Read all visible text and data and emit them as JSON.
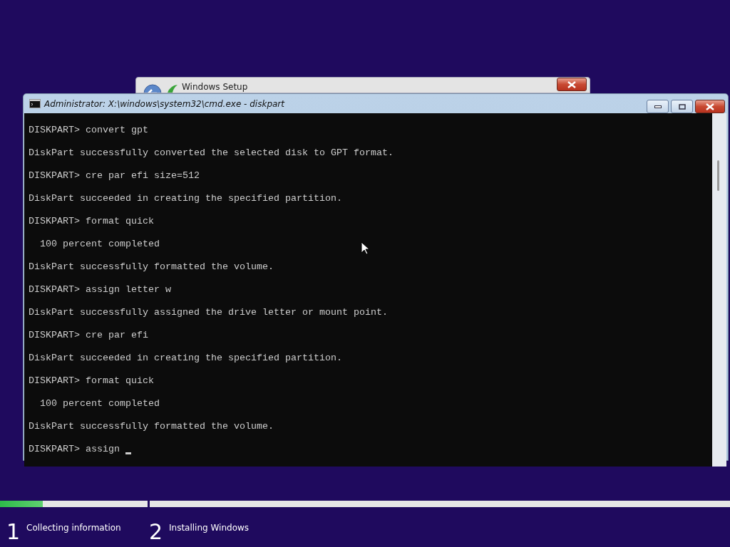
{
  "setup_window": {
    "title": "Windows Setup"
  },
  "console_window": {
    "title": "Administrator: X:\\windows\\system32\\cmd.exe - diskpart",
    "lines": [
      {
        "kind": "command",
        "text": "DISKPART> convert gpt"
      },
      {
        "kind": "output",
        "text": "DiskPart successfully converted the selected disk to GPT format."
      },
      {
        "kind": "command",
        "text": "DISKPART> cre par efi size=512"
      },
      {
        "kind": "output",
        "text": "DiskPart succeeded in creating the specified partition."
      },
      {
        "kind": "command",
        "text": "DISKPART> format quick"
      },
      {
        "kind": "output",
        "text": "  100 percent completed"
      },
      {
        "kind": "output",
        "text": "DiskPart successfully formatted the volume."
      },
      {
        "kind": "command",
        "text": "DISKPART> assign letter w"
      },
      {
        "kind": "output",
        "text": "DiskPart successfully assigned the drive letter or mount point."
      },
      {
        "kind": "command",
        "text": "DISKPART> cre par efi"
      },
      {
        "kind": "output",
        "text": "DiskPart succeeded in creating the specified partition."
      },
      {
        "kind": "command",
        "text": "DISKPART> format quick"
      },
      {
        "kind": "output",
        "text": "  100 percent completed"
      },
      {
        "kind": "output",
        "text": "DiskPart successfully formatted the volume."
      },
      {
        "kind": "prompt",
        "text": "DISKPART> assign "
      }
    ]
  },
  "progress": [
    {
      "level": 0.29
    },
    {
      "level": 0
    }
  ],
  "steps": [
    {
      "number": "1",
      "label": "Collecting information"
    },
    {
      "number": "2",
      "label": "Installing Windows"
    }
  ]
}
